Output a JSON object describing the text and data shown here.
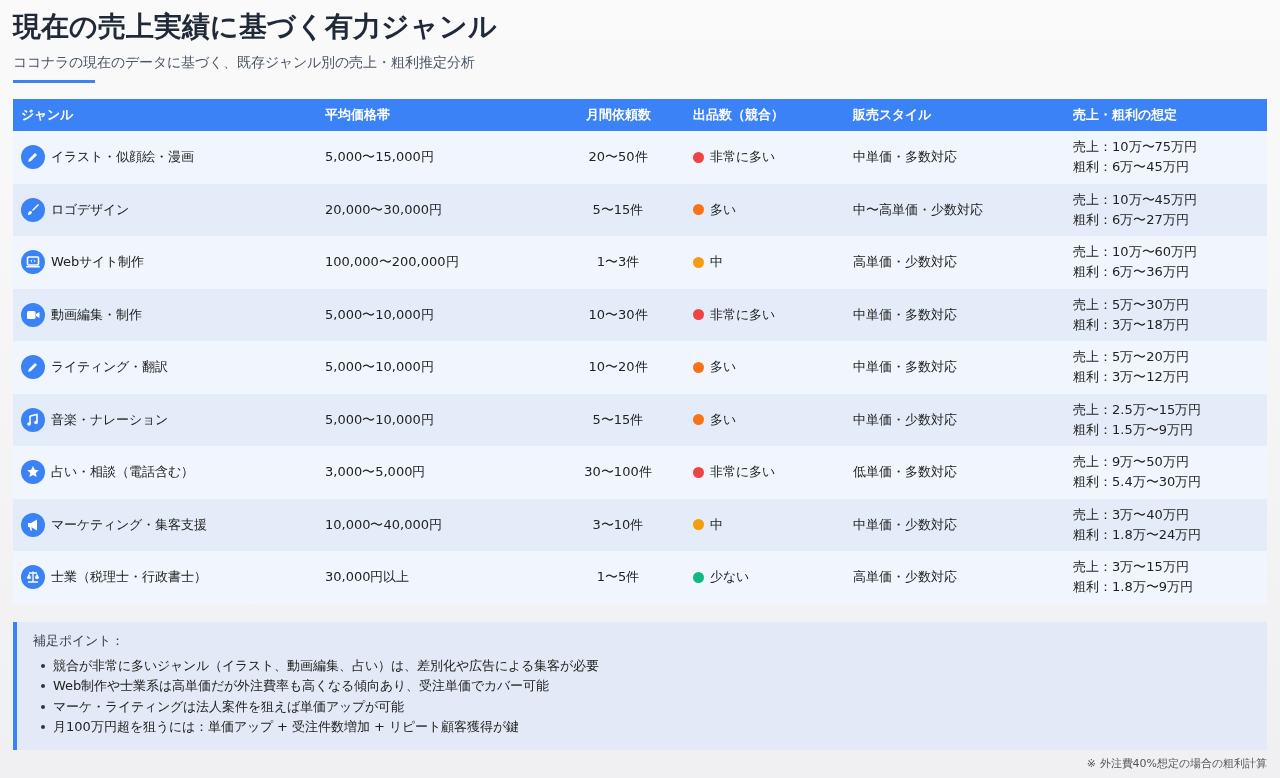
{
  "header": {
    "title": "現在の売上実績に基づく有力ジャンル",
    "subtitle": "ココナラの現在のデータに基づく、既存ジャンル別の売上・粗利推定分析"
  },
  "table": {
    "columns": [
      "ジャンル",
      "平均価格帯",
      "月間依頼数",
      "出品数（競合）",
      "販売スタイル",
      "売上・粗利の想定"
    ],
    "rows": [
      {
        "kind": "pencil",
        "genre": "イラスト・似顔絵・漫画",
        "price": "5,000〜15,000円",
        "requests": "20〜50件",
        "competition": "非常に多い",
        "color": "#ef4444",
        "style": "中単価・多数対応",
        "sales": "売上：10万〜75万円",
        "profit": "粗利：6万〜45万円"
      },
      {
        "kind": "brush",
        "genre": "ロゴデザイン",
        "price": "20,000〜30,000円",
        "requests": "5〜15件",
        "competition": "多い",
        "color": "#f97316",
        "style": "中〜高単価・少数対応",
        "sales": "売上：10万〜45万円",
        "profit": "粗利：6万〜27万円"
      },
      {
        "kind": "laptop",
        "genre": "Webサイト制作",
        "price": "100,000〜200,000円",
        "requests": "1〜3件",
        "competition": "中",
        "color": "#f59e0b",
        "style": "高単価・少数対応",
        "sales": "売上：10万〜60万円",
        "profit": "粗利：6万〜36万円"
      },
      {
        "kind": "video",
        "genre": "動画編集・制作",
        "price": "5,000〜10,000円",
        "requests": "10〜30件",
        "competition": "非常に多い",
        "color": "#ef4444",
        "style": "中単価・多数対応",
        "sales": "売上：5万〜30万円",
        "profit": "粗利：3万〜18万円"
      },
      {
        "kind": "pencil",
        "genre": "ライティング・翻訳",
        "price": "5,000〜10,000円",
        "requests": "10〜20件",
        "competition": "多い",
        "color": "#f97316",
        "style": "中単価・多数対応",
        "sales": "売上：5万〜20万円",
        "profit": "粗利：3万〜12万円"
      },
      {
        "kind": "music",
        "genre": "音楽・ナレーション",
        "price": "5,000〜10,000円",
        "requests": "5〜15件",
        "competition": "多い",
        "color": "#f97316",
        "style": "中単価・少数対応",
        "sales": "売上：2.5万〜15万円",
        "profit": "粗利：1.5万〜9万円"
      },
      {
        "kind": "star",
        "genre": "占い・相談（電話含む）",
        "price": "3,000〜5,000円",
        "requests": "30〜100件",
        "competition": "非常に多い",
        "color": "#ef4444",
        "style": "低単価・多数対応",
        "sales": "売上：9万〜50万円",
        "profit": "粗利：5.4万〜30万円"
      },
      {
        "kind": "megaphone",
        "genre": "マーケティング・集客支援",
        "price": "10,000〜40,000円",
        "requests": "3〜10件",
        "competition": "中",
        "color": "#f59e0b",
        "style": "中単価・少数対応",
        "sales": "売上：3万〜40万円",
        "profit": "粗利：1.8万〜24万円"
      },
      {
        "kind": "scale",
        "genre": "士業（税理士・行政書士）",
        "price": "30,000円以上",
        "requests": "1〜5件",
        "competition": "少ない",
        "color": "#10b981",
        "style": "高単価・少数対応",
        "sales": "売上：3万〜15万円",
        "profit": "粗利：1.8万〜9万円"
      }
    ]
  },
  "notes": {
    "title": "補足ポイント：",
    "items": [
      "競合が非常に多いジャンル（イラスト、動画編集、占い）は、差別化や広告による集客が必要",
      "Web制作や士業系は高単価だが外注費率も高くなる傾向あり、受注単価でカバー可能",
      "マーケ・ライティングは法人案件を狙えば単価アップが可能",
      "月100万円超を狙うには：単価アップ + 受注件数増加 + リピート顧客獲得が鍵"
    ]
  },
  "footnote": "※ 外注費40%想定の場合の粗利計算"
}
